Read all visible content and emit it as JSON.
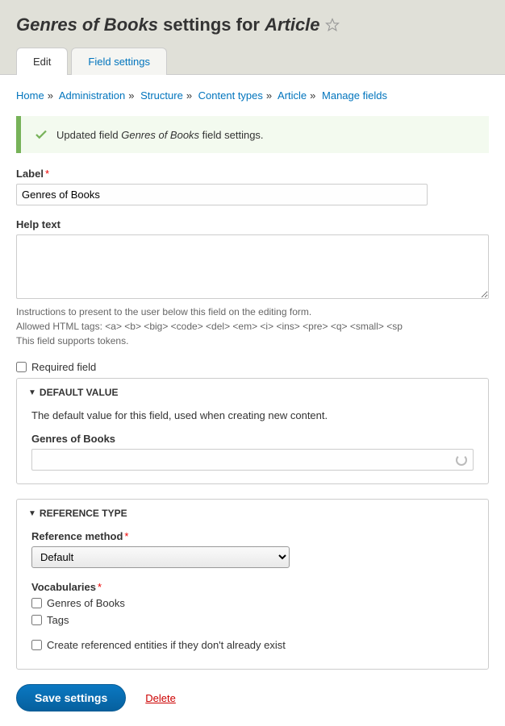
{
  "title": {
    "prefix": "Genres of Books",
    "middle": " settings for ",
    "suffix": "Article"
  },
  "tabs": {
    "edit": "Edit",
    "field_settings": "Field settings"
  },
  "breadcrumb": {
    "home": "Home",
    "admin": "Administration",
    "structure": "Structure",
    "content_types": "Content types",
    "article": "Article",
    "manage": "Manage fields"
  },
  "status": {
    "pre": "Updated field ",
    "name": "Genres of Books",
    "post": " field settings."
  },
  "labels": {
    "label": "Label",
    "help_text": "Help text",
    "default_value_legend": "Default Value",
    "reference_type_legend": "Reference Type",
    "reference_method": "Reference method",
    "vocabularies": "Vocabularies",
    "required_field": "Required field",
    "create_referenced": "Create referenced entities if they don't already exist",
    "genres_of_books": "Genres of Books"
  },
  "values": {
    "label_input": "Genres of Books",
    "help_textarea": "",
    "default_value_input": ""
  },
  "help_desc": {
    "l1": "Instructions to present to the user below this field on the editing form.",
    "l2": "Allowed HTML tags: <a> <b> <big> <code> <del> <em> <i> <ins> <pre> <q> <small> <sp",
    "l3": "This field supports tokens."
  },
  "default_value_desc": "The default value for this field, used when creating new content.",
  "reference_method_value": "Default",
  "vocabularies_options": {
    "genres": "Genres of Books",
    "tags": "Tags"
  },
  "actions": {
    "save": "Save settings",
    "delete": "Delete"
  }
}
